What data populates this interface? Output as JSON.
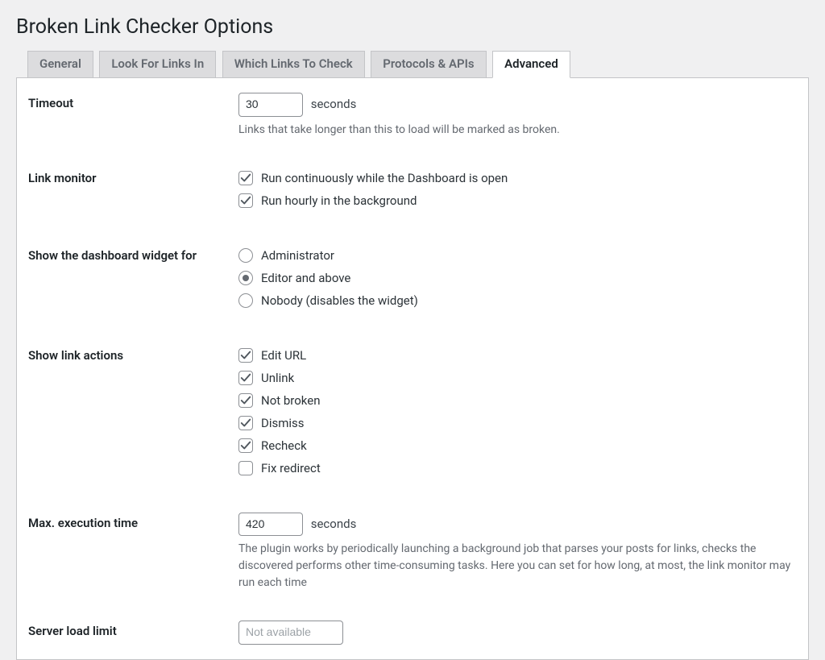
{
  "page": {
    "title": "Broken Link Checker Options"
  },
  "tabs": [
    {
      "label": "General"
    },
    {
      "label": "Look For Links In"
    },
    {
      "label": "Which Links To Check"
    },
    {
      "label": "Protocols & APIs"
    },
    {
      "label": "Advanced"
    }
  ],
  "timeout": {
    "label": "Timeout",
    "value": "30",
    "unit": "seconds",
    "description": "Links that take longer than this to load will be marked as broken."
  },
  "link_monitor": {
    "label": "Link monitor",
    "options": [
      {
        "label": "Run continuously while the Dashboard is open",
        "checked": true
      },
      {
        "label": "Run hourly in the background",
        "checked": true
      }
    ]
  },
  "dashboard_widget": {
    "label": "Show the dashboard widget for",
    "options": [
      {
        "label": "Administrator",
        "checked": false
      },
      {
        "label": "Editor and above",
        "checked": true
      },
      {
        "label": "Nobody (disables the widget)",
        "checked": false
      }
    ]
  },
  "link_actions": {
    "label": "Show link actions",
    "options": [
      {
        "label": "Edit URL",
        "checked": true
      },
      {
        "label": "Unlink",
        "checked": true
      },
      {
        "label": "Not broken",
        "checked": true
      },
      {
        "label": "Dismiss",
        "checked": true
      },
      {
        "label": "Recheck",
        "checked": true
      },
      {
        "label": "Fix redirect",
        "checked": false
      }
    ]
  },
  "max_exec": {
    "label": "Max. execution time",
    "value": "420",
    "unit": "seconds",
    "description": "The plugin works by periodically launching a background job that parses your posts for links, checks the discovered performs other time-consuming tasks. Here you can set for how long, at most, the link monitor may run each time"
  },
  "server_load": {
    "label": "Server load limit",
    "placeholder": "Not available"
  }
}
